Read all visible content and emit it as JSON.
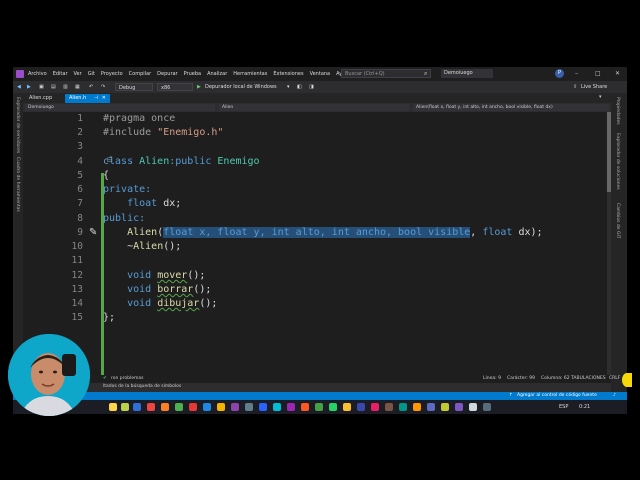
{
  "menubar": {
    "menus": [
      "Archivo",
      "Editar",
      "Ver",
      "Git",
      "Proyecto",
      "Compilar",
      "Depurar",
      "Prueba",
      "Analizar",
      "Herramientas",
      "Extensiones",
      "Ventana",
      "Ayuda"
    ],
    "search_placeholder": "Buscar (Ctrl+Q)",
    "project_name": "Demoiuego",
    "avatar_initial": "P"
  },
  "toolbar": {
    "config": "Debug",
    "platform": "x86",
    "run_label": "Depurador local de Windows",
    "live_share": "Live Share"
  },
  "left_strip": {
    "items": [
      "Explorador de servidores",
      "Cuadro de herramientas"
    ]
  },
  "right_strip": {
    "items": [
      "Propiedades",
      "Explorador de soluciones",
      "Cambios de GIT"
    ]
  },
  "tabs": [
    {
      "label": "Alien.cpp",
      "active": false
    },
    {
      "label": "Alien.h",
      "active": true
    }
  ],
  "navbar": {
    "project": "Demoiuego",
    "scope": "Alien",
    "member": "Alien(float x, float y, int alto, int ancho, bool visible, float dx)"
  },
  "editor": {
    "line_numbers": [
      "1",
      "2",
      "3",
      "4",
      "5",
      "6",
      "7",
      "8",
      "9",
      "10",
      "11",
      "12",
      "13",
      "14",
      "15"
    ],
    "lines": {
      "l1": "#pragma once",
      "l2_a": "#include ",
      "l2_b": "\"Enemigo.h\"",
      "l4_a": "class ",
      "l4_b": "Alien",
      "l4_c": ":public ",
      "l4_d": "Enemigo",
      "l5": "{",
      "l6": "private:",
      "l7_a": "float ",
      "l7_b": "dx;",
      "l8": "public:",
      "l9_a": "Alien",
      "l9_b": "(",
      "l9_c": "float x, float y, int alto, int ancho, bool visible",
      "l9_d": ", ",
      "l9_e": "float ",
      "l9_f": "dx);",
      "l10_a": "~",
      "l10_b": "Alien",
      "l10_c": "();",
      "l12_a": "void ",
      "l12_b": "mover",
      "l12_c": "();",
      "l13_a": "void ",
      "l13_b": "borrar",
      "l13_c": "();",
      "l14_a": "void ",
      "l14_b": "dibujar",
      "l14_c": "();",
      "l15": "};"
    }
  },
  "error_strip": {
    "problems": "ron problemas",
    "position": "Línea: 9",
    "char": "Carácter: 99",
    "col": "Columna: 62",
    "tabs": "TABULACIONES",
    "eol": "CRLF"
  },
  "output": {
    "text": "ltados de la búsqueda de símbolos"
  },
  "statusbar": {
    "source_control": "Agregar al control de código fuente"
  },
  "taskbar": {
    "lang": "ESP",
    "time": "0:21"
  },
  "colors": {
    "accent": "#007acc",
    "keyword": "#569cd6",
    "type": "#4ec9b0",
    "function": "#dcdcaa",
    "string": "#d69d85",
    "selection": "#264f78"
  }
}
